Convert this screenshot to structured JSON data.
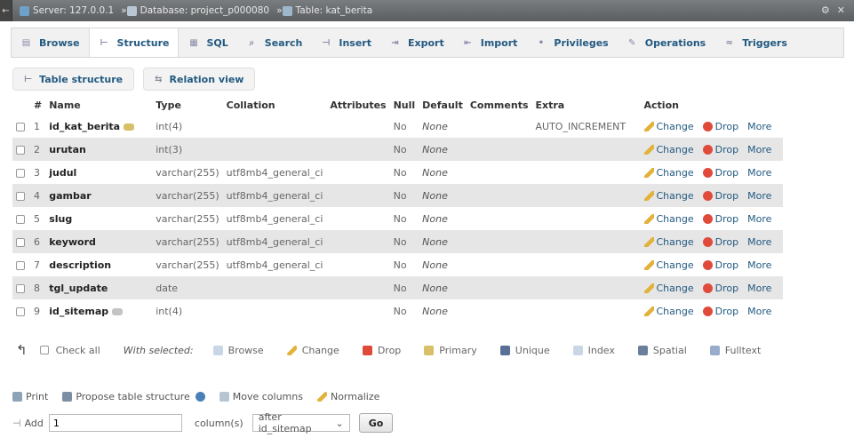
{
  "breadcrumb": {
    "server": "Server: 127.0.0.1",
    "database": "Database: project_p000080",
    "table": "Table: kat_berita"
  },
  "tabs": [
    {
      "label": "Browse",
      "icon": "browse-icon"
    },
    {
      "label": "Structure",
      "icon": "structure-icon"
    },
    {
      "label": "SQL",
      "icon": "sql-icon"
    },
    {
      "label": "Search",
      "icon": "search-icon"
    },
    {
      "label": "Insert",
      "icon": "insert-icon"
    },
    {
      "label": "Export",
      "icon": "export-icon"
    },
    {
      "label": "Import",
      "icon": "import-icon"
    },
    {
      "label": "Privileges",
      "icon": "privileges-icon"
    },
    {
      "label": "Operations",
      "icon": "operations-icon"
    },
    {
      "label": "Triggers",
      "icon": "triggers-icon"
    }
  ],
  "subtabs": [
    {
      "label": "Table structure",
      "icon": "structure-icon"
    },
    {
      "label": "Relation view",
      "icon": "relation-icon"
    }
  ],
  "columns": {
    "num": "#",
    "name": "Name",
    "type": "Type",
    "collation": "Collation",
    "attributes": "Attributes",
    "null": "Null",
    "default": "Default",
    "comments": "Comments",
    "extra": "Extra",
    "action": "Action"
  },
  "rows": [
    {
      "num": "1",
      "name": "id_kat_berita",
      "key": true,
      "type": "int(4)",
      "collation": "",
      "null": "No",
      "default": "None",
      "extra": "AUTO_INCREMENT"
    },
    {
      "num": "2",
      "name": "urutan",
      "key": false,
      "type": "int(3)",
      "collation": "",
      "null": "No",
      "default": "None",
      "extra": ""
    },
    {
      "num": "3",
      "name": "judul",
      "key": false,
      "type": "varchar(255)",
      "collation": "utf8mb4_general_ci",
      "null": "No",
      "default": "None",
      "extra": ""
    },
    {
      "num": "4",
      "name": "gambar",
      "key": false,
      "type": "varchar(255)",
      "collation": "utf8mb4_general_ci",
      "null": "No",
      "default": "None",
      "extra": ""
    },
    {
      "num": "5",
      "name": "slug",
      "key": false,
      "type": "varchar(255)",
      "collation": "utf8mb4_general_ci",
      "null": "No",
      "default": "None",
      "extra": ""
    },
    {
      "num": "6",
      "name": "keyword",
      "key": false,
      "type": "varchar(255)",
      "collation": "utf8mb4_general_ci",
      "null": "No",
      "default": "None",
      "extra": ""
    },
    {
      "num": "7",
      "name": "description",
      "key": false,
      "type": "varchar(255)",
      "collation": "utf8mb4_general_ci",
      "null": "No",
      "default": "None",
      "extra": ""
    },
    {
      "num": "8",
      "name": "tgl_update",
      "key": false,
      "type": "date",
      "collation": "",
      "null": "No",
      "default": "None",
      "extra": ""
    },
    {
      "num": "9",
      "name": "id_sitemap",
      "key": true,
      "type": "int(4)",
      "collation": "",
      "null": "No",
      "default": "None",
      "extra": ""
    }
  ],
  "row_actions": {
    "change": "Change",
    "drop": "Drop",
    "more": "More"
  },
  "bulk": {
    "check_all": "Check all",
    "with_selected": "With selected:",
    "actions": [
      "Browse",
      "Change",
      "Drop",
      "Primary",
      "Unique",
      "Index",
      "Spatial",
      "Fulltext"
    ]
  },
  "footer": {
    "print": "Print",
    "propose": "Propose table structure",
    "move_columns": "Move columns",
    "normalize": "Normalize",
    "add_label": "Add",
    "add_value": "1",
    "columns_label": "column(s)",
    "position_value": "after id_sitemap",
    "go": "Go"
  }
}
